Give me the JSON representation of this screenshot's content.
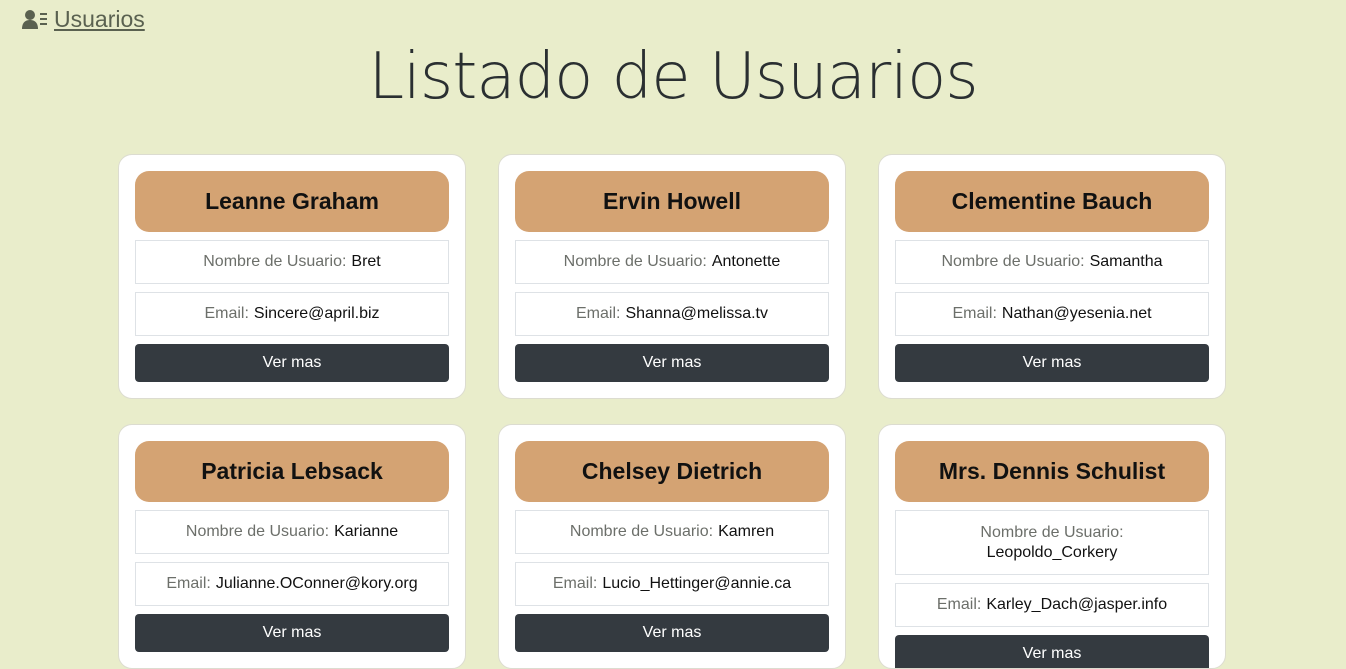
{
  "nav": {
    "link_label": "Usuarios",
    "icon": "user-list-icon"
  },
  "page": {
    "title": "Listado de Usuarios"
  },
  "labels": {
    "username": "Nombre de Usuario:",
    "email": "Email:",
    "more_button": "Ver mas"
  },
  "users": [
    {
      "name": "Leanne Graham",
      "username": "Bret",
      "email": "Sincere@april.biz"
    },
    {
      "name": "Ervin Howell",
      "username": "Antonette",
      "email": "Shanna@melissa.tv"
    },
    {
      "name": "Clementine Bauch",
      "username": "Samantha",
      "email": "Nathan@yesenia.net"
    },
    {
      "name": "Patricia Lebsack",
      "username": "Karianne",
      "email": "Julianne.OConner@kory.org"
    },
    {
      "name": "Chelsey Dietrich",
      "username": "Kamren",
      "email": "Lucio_Hettinger@annie.ca"
    },
    {
      "name": "Mrs. Dennis Schulist",
      "username": "Leopoldo_Corkery",
      "email": "Karley_Dach@jasper.info"
    }
  ],
  "colors": {
    "background": "#e9edcb",
    "name_header": "#d4a373",
    "button": "#343a40"
  }
}
